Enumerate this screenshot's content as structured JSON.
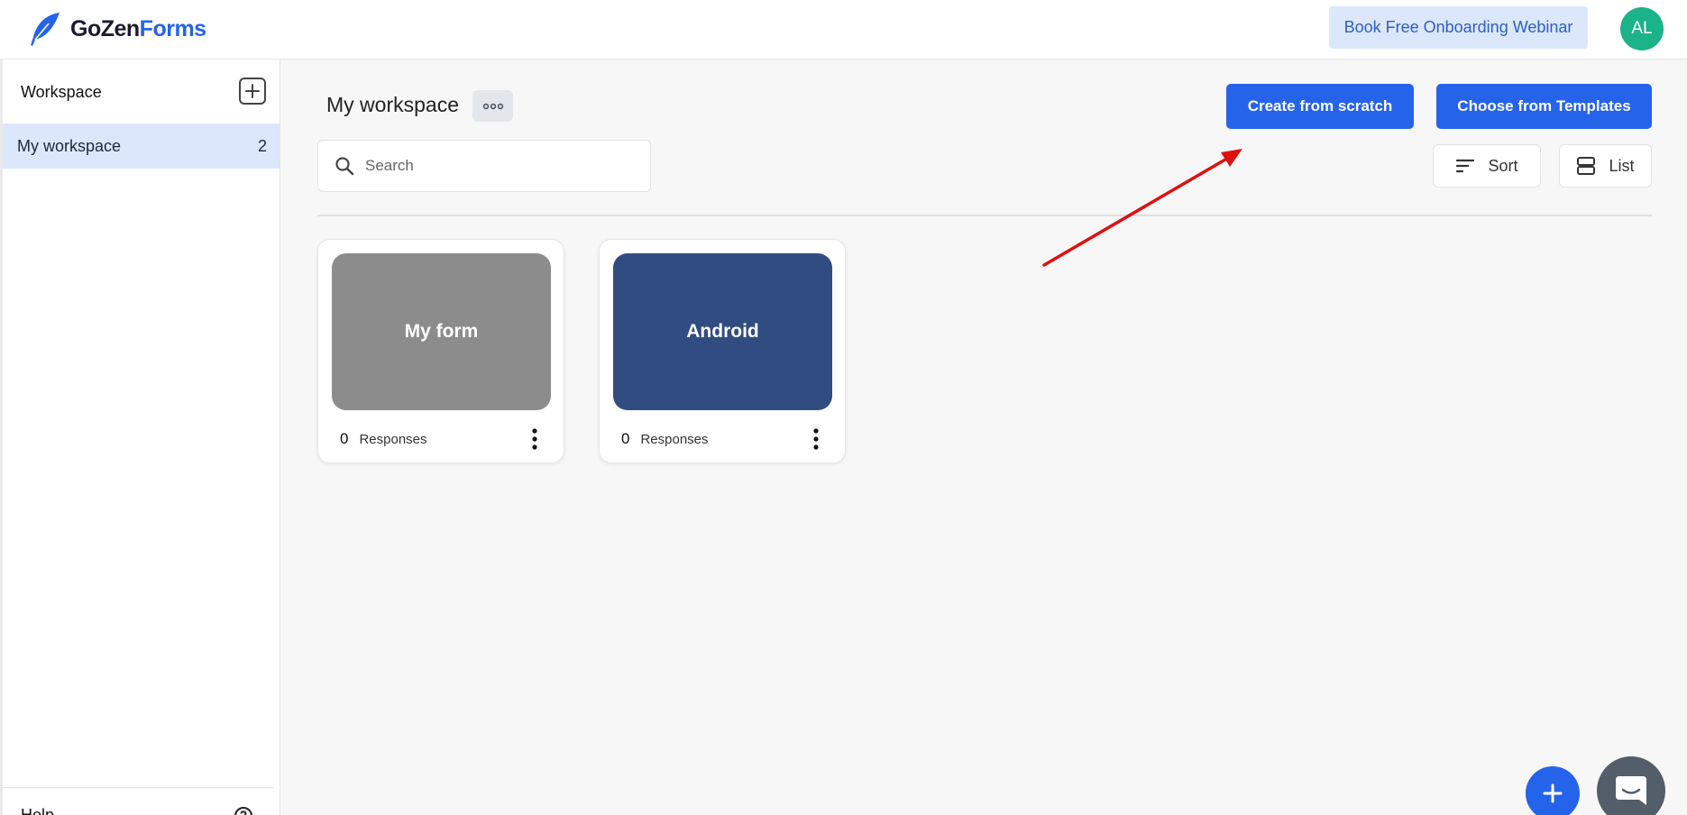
{
  "brand": {
    "name_part1": "GoZen",
    "name_part2": "Forms"
  },
  "header": {
    "webinar_label": "Book Free Onboarding Webinar",
    "avatar_initials": "AL",
    "avatar_color": "#1cb38a"
  },
  "sidebar": {
    "title": "Workspace",
    "items": [
      {
        "label": "My workspace",
        "count": "2"
      }
    ],
    "help_label": "Help"
  },
  "main": {
    "workspace_title": "My workspace",
    "create_label": "Create from scratch",
    "templates_label": "Choose from Templates",
    "search_placeholder": "Search",
    "sort_label": "Sort",
    "list_label": "List",
    "forms": [
      {
        "name": "My form",
        "responses": "0",
        "responses_label": "Responses",
        "color": "#8c8c8c"
      },
      {
        "name": "Android",
        "responses": "0",
        "responses_label": "Responses",
        "color": "#314c80"
      }
    ]
  },
  "colors": {
    "accent": "#2563eb",
    "selected_bg": "#dbe7fb",
    "annotation_arrow": "#e01010"
  },
  "icons": [
    "feather-logo-icon",
    "plus-icon",
    "more-horizontal-icon",
    "search-icon",
    "sort-icon",
    "list-view-icon",
    "more-vertical-icon",
    "help-circle-icon",
    "chat-icon"
  ]
}
